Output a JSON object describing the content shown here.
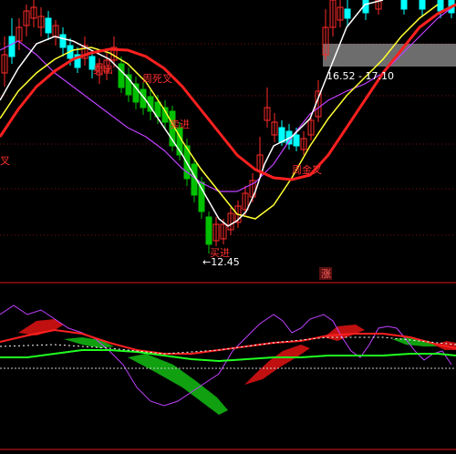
{
  "chart_data": [
    {
      "type": "candlestick",
      "colors": {
        "background": "#000000",
        "up_candle": "#ff2a2a",
        "down_candle": "#00ffff",
        "down_candle_deep": "#00c000",
        "ma_white": "#ffffff",
        "ma_yellow": "#ffff33",
        "ma_magenta": "#c040ff",
        "ma_red": "#ff2020",
        "label_text": "#ff3030",
        "price_text": "#ffffff",
        "grid": "#7a1010",
        "range_box": "#808080"
      },
      "annotations": {
        "range_text": "16.52 - 17.10",
        "low_price_text": "←12.45",
        "low_label": "买进",
        "sell_label": "卖出",
        "weekly_death_cross": "周死叉",
        "weekly_golden_cross": "周金叉",
        "left_edge_label": "叉",
        "zhang_badge": "涨",
        "mid_label": "卖进",
        "low_label_2": "买进"
      }
    },
    {
      "type": "oscillator",
      "colors": {
        "red_fill": "#c01010",
        "green_fill": "#10a010",
        "line_red": "#ff2020",
        "line_green": "#20ff20",
        "line_magenta": "#c040ff",
        "dashed": "#cccccc"
      }
    }
  ]
}
